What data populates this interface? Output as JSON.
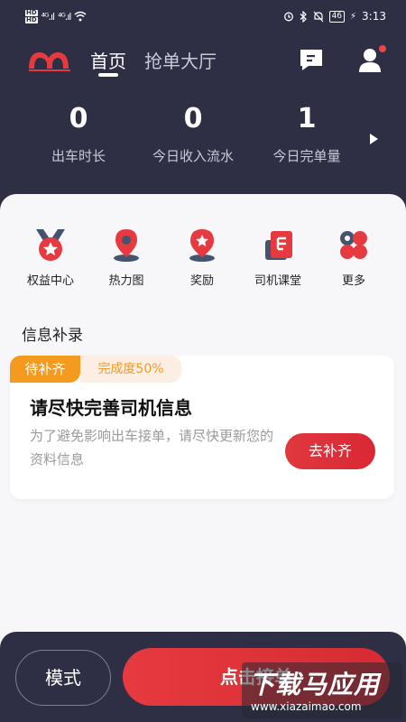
{
  "status_bar": {
    "hd1": "HD",
    "hd2": "HD",
    "sig1": "⁴ᴳ.ıl",
    "sig2": "⁴ᴳ.ıl",
    "battery": "46",
    "time": "3:13"
  },
  "nav": {
    "tabs": [
      {
        "label": "首页",
        "active": true
      },
      {
        "label": "抢单大厅",
        "active": false
      }
    ],
    "accent": "#e63a40"
  },
  "stats": [
    {
      "value": "0",
      "label": "出车时长"
    },
    {
      "value": "0",
      "label": "今日收入流水"
    },
    {
      "value": "1",
      "label": "今日完单量"
    }
  ],
  "features": [
    {
      "label": "权益中心",
      "icon": "rights-center-icon"
    },
    {
      "label": "热力图",
      "icon": "heatmap-pin-icon"
    },
    {
      "label": "奖励",
      "icon": "reward-pin-icon"
    },
    {
      "label": "司机课堂",
      "icon": "driver-class-icon"
    },
    {
      "label": "更多",
      "icon": "more-grid-icon"
    }
  ],
  "info_section": {
    "title": "信息补录",
    "card": {
      "status": "待补齐",
      "progress": "完成度50%",
      "title": "请尽快完善司机信息",
      "description": "为了避免影响出车接单，请尽快更新您的资料信息",
      "button": "去补齐"
    }
  },
  "bottom_bar": {
    "mode_button": "模式",
    "start_button": "点击接单"
  },
  "watermark": {
    "main": "下载马应用",
    "sub": "www.xiazaimao.com"
  }
}
